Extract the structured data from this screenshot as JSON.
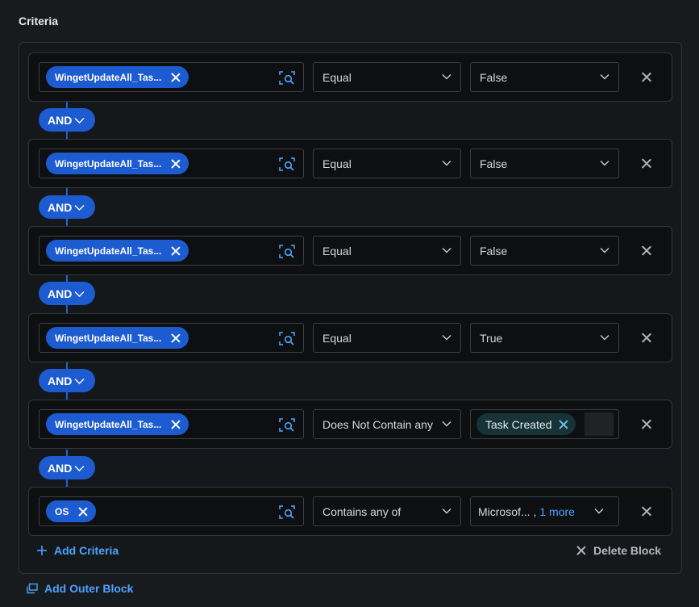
{
  "section_title": "Criteria",
  "connector_label": "AND",
  "rows": [
    {
      "field": "WingetUpdateAll_Tas...",
      "operator": "Equal",
      "value": "False"
    },
    {
      "field": "WingetUpdateAll_Tas...",
      "operator": "Equal",
      "value": "False"
    },
    {
      "field": "WingetUpdateAll_Tas...",
      "operator": "Equal",
      "value": "False"
    },
    {
      "field": "WingetUpdateAll_Tas...",
      "operator": "Equal",
      "value": "True"
    },
    {
      "field": "WingetUpdateAll_Tas...",
      "operator": "Does Not Contain any",
      "value_chip": "Task Created"
    },
    {
      "field": "OS",
      "operator": "Contains any of",
      "value_prefix": "Microsof... ,",
      "value_more": "1 more"
    }
  ],
  "actions": {
    "add_criteria": "Add Criteria",
    "delete_block": "Delete Block",
    "add_outer_block": "Add Outer Block"
  },
  "icons": {
    "field_search": "search-field-icon",
    "chevron": "chevron-down-icon",
    "remove": "close-icon",
    "add": "plus-icon",
    "outer_block": "add-block-icon"
  },
  "colors": {
    "accent": "#1d5bd0",
    "link": "#4da3ff",
    "background": "#181b1e",
    "row_background": "#0d0f11",
    "value_chip": "#173338"
  }
}
